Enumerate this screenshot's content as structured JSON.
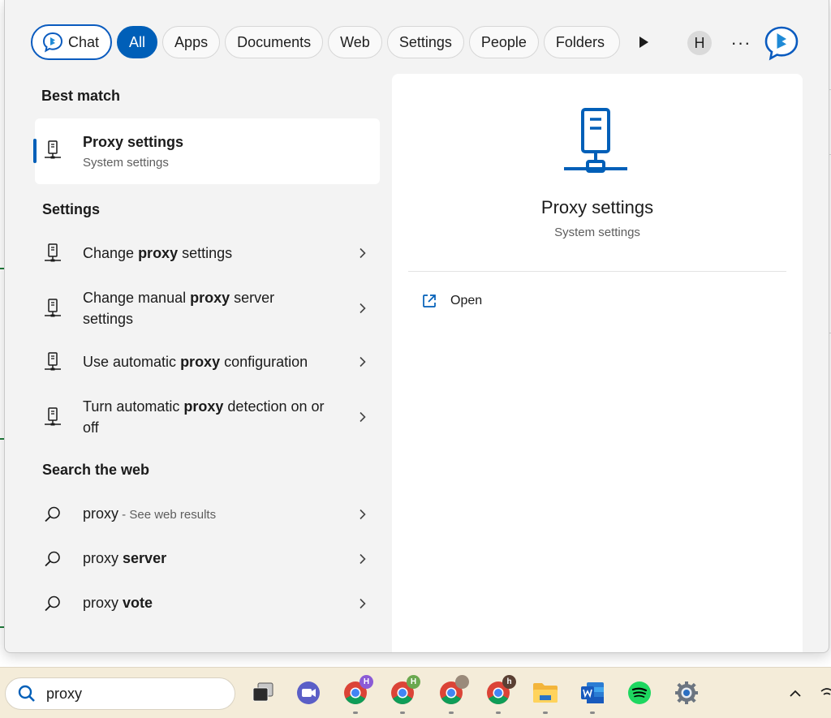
{
  "filters": {
    "chat_label": "Chat",
    "items": [
      "All",
      "Apps",
      "Documents",
      "Web",
      "Settings",
      "People",
      "Folders"
    ],
    "active": "All",
    "profile_initial": "H",
    "more_label": "···"
  },
  "best_match": {
    "heading": "Best match",
    "title": "Proxy settings",
    "subtitle": "System settings"
  },
  "settings": {
    "heading": "Settings",
    "items": [
      {
        "pre": "Change ",
        "bold": "proxy",
        "post": " settings"
      },
      {
        "pre": "Change manual ",
        "bold": "proxy",
        "post": " server settings"
      },
      {
        "pre": "Use automatic ",
        "bold": "proxy",
        "post": " configuration"
      },
      {
        "pre": "Turn automatic ",
        "bold": "proxy",
        "post": " detection on or off"
      }
    ]
  },
  "web": {
    "heading": "Search the web",
    "items": [
      {
        "pre": "proxy",
        "bold": "",
        "hint": " - See web results"
      },
      {
        "pre": "proxy ",
        "bold": "server",
        "hint": ""
      },
      {
        "pre": "proxy ",
        "bold": "vote",
        "hint": ""
      }
    ]
  },
  "detail": {
    "title": "Proxy settings",
    "subtitle": "System settings",
    "open_label": "Open"
  },
  "taskbar": {
    "search_value": "proxy",
    "badges": [
      "H",
      "H",
      "h"
    ]
  },
  "colors": {
    "accent": "#005fb8",
    "panel_bg": "#f3f3f3",
    "taskbar_bg": "#f4ecd9"
  }
}
